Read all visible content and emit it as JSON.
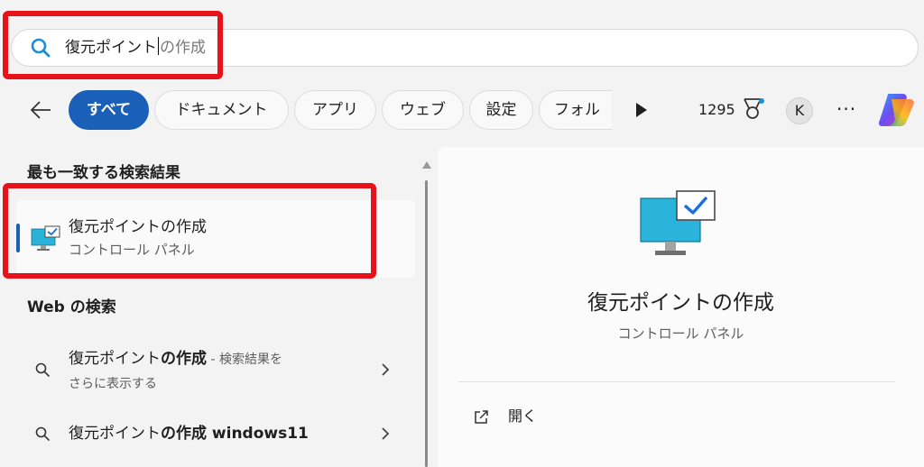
{
  "search": {
    "typed": "復元ポイント",
    "hint": "の作成"
  },
  "filters": {
    "chips": [
      "すべて",
      "ドキュメント",
      "アプリ",
      "ウェブ",
      "設定",
      "フォル"
    ],
    "points": "1295",
    "avatar_initial": "K",
    "more": "···"
  },
  "results": {
    "best_match_heading": "最も一致する検索結果",
    "best_match": {
      "title": "復元ポイントの作成",
      "subtitle": "コントロール パネル"
    },
    "web_heading": "Web の検索",
    "web_items": [
      {
        "normal": "復元ポイント",
        "bold": "の作成",
        "suffix": " - 検索結果を",
        "line2": "さらに表示する"
      },
      {
        "normal": "復元ポイント",
        "bold": "の作成 windows11",
        "suffix": "",
        "line2": ""
      }
    ]
  },
  "preview": {
    "title": "復元ポイントの作成",
    "subtitle": "コントロール パネル",
    "actions": [
      {
        "label": "開く"
      }
    ]
  },
  "colors": {
    "accent": "#1a5fb8",
    "highlight_box": "#e8121b",
    "search_icon": "#1a8fd6"
  },
  "icons": {
    "search": "search-icon",
    "back": "back-arrow-icon",
    "play": "play-icon",
    "rewards": "rewards-icon",
    "copilot": "copilot-icon",
    "app": "system-restore-icon",
    "open": "open-external-icon",
    "chevron": "chevron-right-icon"
  }
}
